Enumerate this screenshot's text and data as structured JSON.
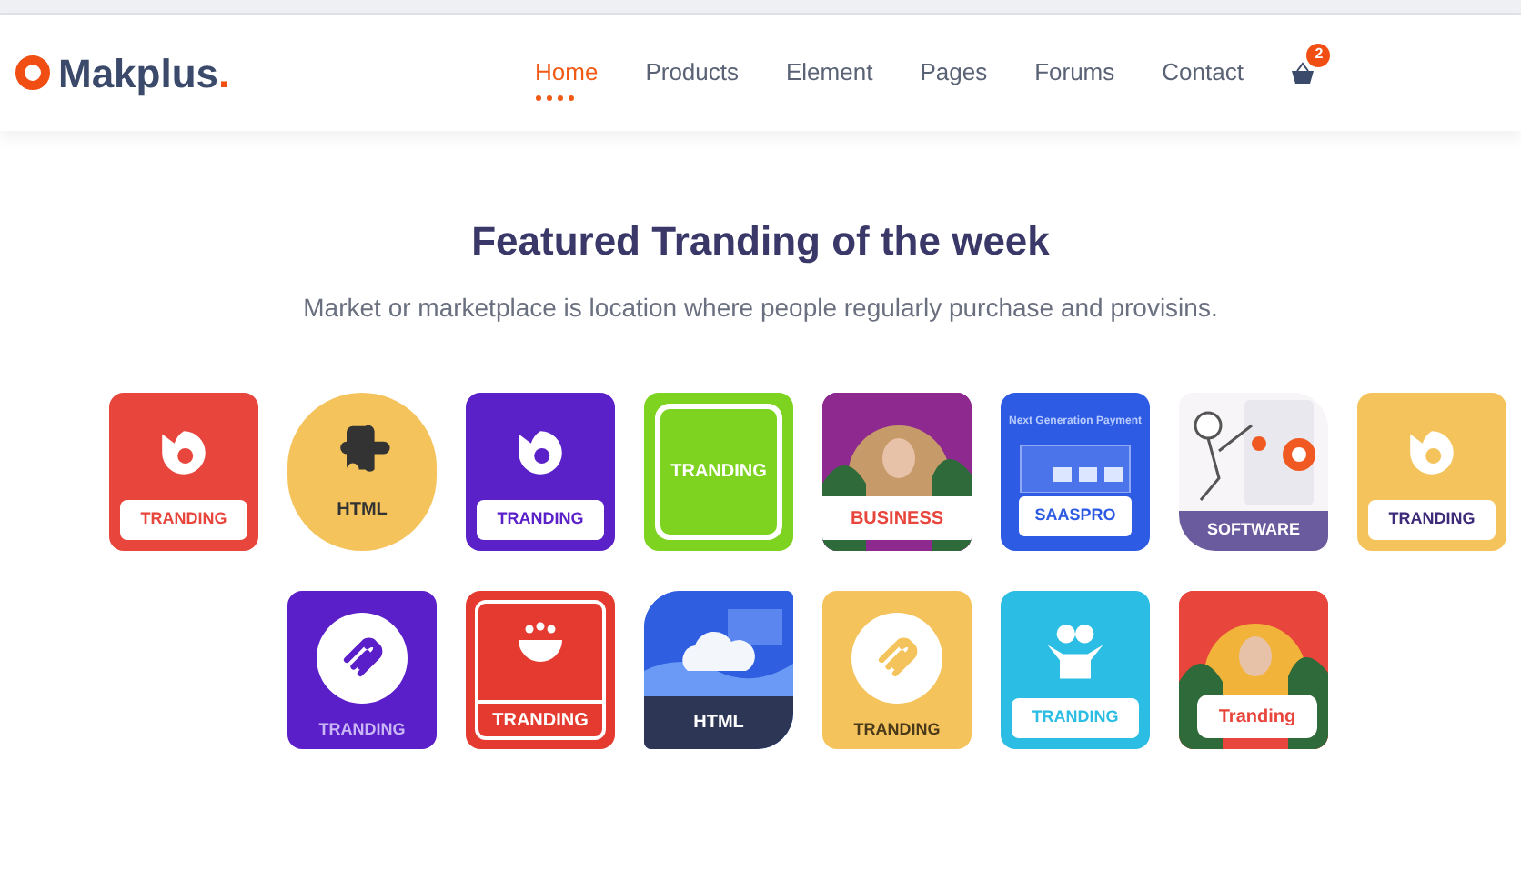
{
  "logo": {
    "name": "Makplus",
    "dot": "."
  },
  "nav": [
    {
      "label": "Home",
      "selected": true
    },
    {
      "label": "Products",
      "selected": false
    },
    {
      "label": "Element",
      "selected": false
    },
    {
      "label": "Pages",
      "selected": false
    },
    {
      "label": "Forums",
      "selected": false
    },
    {
      "label": "Contact",
      "selected": false
    }
  ],
  "cart": {
    "count": "2"
  },
  "heading": "Featured Tranding of the week",
  "subheading": "Market or marketplace is location where people regularly purchase and provisins.",
  "rows": [
    [
      {
        "kind": "badge",
        "label": "TRANDING",
        "color": "#e8453c"
      },
      {
        "kind": "circle",
        "label": "HTML",
        "color": "#f5c35c"
      },
      {
        "kind": "badge",
        "label": "TRANDING",
        "color": "#5b21c9"
      },
      {
        "kind": "framed",
        "label": "TRANDING",
        "color": "#7ed321"
      },
      {
        "label": "BUSINESS",
        "color": "#8e2a8f"
      },
      {
        "kind": "screen",
        "label": "SAASPRO",
        "color": "#2d5be3",
        "caption": "Next Generation Payment"
      },
      {
        "kind": "band",
        "label": "SOFTWARE",
        "color": "#6a5a9e"
      },
      {
        "kind": "badge",
        "label": "TRANDING",
        "color": "#f5c35c"
      }
    ],
    [
      {
        "kind": "plain",
        "label": "TRANDING",
        "color": "#5b1fc9"
      },
      {
        "kind": "boxed",
        "label": "TRANDING",
        "color": "#e53a2f"
      },
      {
        "kind": "cloud",
        "label": "HTML",
        "color": "#2f5fe0"
      },
      {
        "kind": "plain",
        "label": "TRANDING",
        "color": "#f5c35c"
      },
      {
        "kind": "badge",
        "label": "TRANDING",
        "color": "#2bbde3"
      },
      {
        "label": "Tranding",
        "color": "#e8453c"
      }
    ]
  ]
}
